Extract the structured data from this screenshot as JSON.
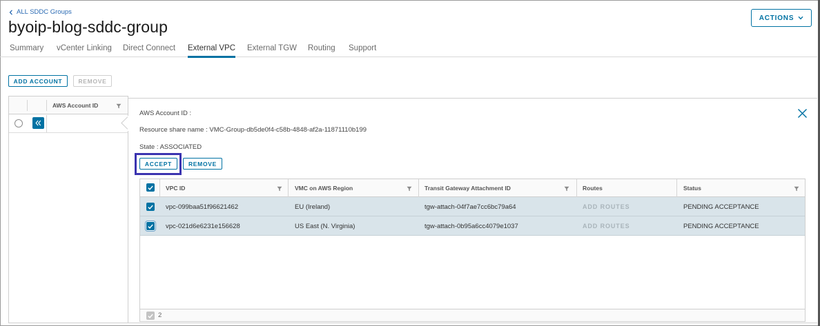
{
  "header": {
    "back_link": "ALL SDDC Groups",
    "title": "byoip-blog-sddc-group",
    "actions_label": "ACTIONS"
  },
  "tabs": [
    {
      "label": "Summary"
    },
    {
      "label": "vCenter Linking"
    },
    {
      "label": "Direct Connect"
    },
    {
      "label": "External VPC",
      "active": true
    },
    {
      "label": "External TGW"
    },
    {
      "label": "Routing"
    },
    {
      "label": "Support"
    }
  ],
  "toolbar": {
    "add_account": "ADD ACCOUNT",
    "remove": "REMOVE"
  },
  "accounts_grid": {
    "column": "AWS Account ID"
  },
  "detail": {
    "account_id_label": "AWS Account ID :",
    "resource_share": "Resource share name : VMC-Group-db5de0f4-c58b-4848-af2a-11871110b199",
    "state": "State : ASSOCIATED",
    "accept": "ACCEPT",
    "remove": "REMOVE"
  },
  "vpc_grid": {
    "columns": [
      "VPC ID",
      "VMC on AWS Region",
      "Transit Gateway Attachment ID",
      "Routes",
      "Status"
    ],
    "rows": [
      {
        "vpc_id": "vpc-099baa51f96621462",
        "region": "EU (Ireland)",
        "attachment": "tgw-attach-04f7ae7cc6bc79a64",
        "routes": "ADD ROUTES",
        "status": "PENDING ACCEPTANCE"
      },
      {
        "vpc_id": "vpc-021d6e6231e156628",
        "region": "US East (N. Virginia)",
        "attachment": "tgw-attach-0b95a6cc4079e1037",
        "routes": "ADD ROUTES",
        "status": "PENDING ACCEPTANCE"
      }
    ],
    "footer_count": "2"
  },
  "colors": {
    "accent": "#0072a3",
    "selected_row": "#d9e4ea",
    "highlight_box": "#3b34b0"
  }
}
